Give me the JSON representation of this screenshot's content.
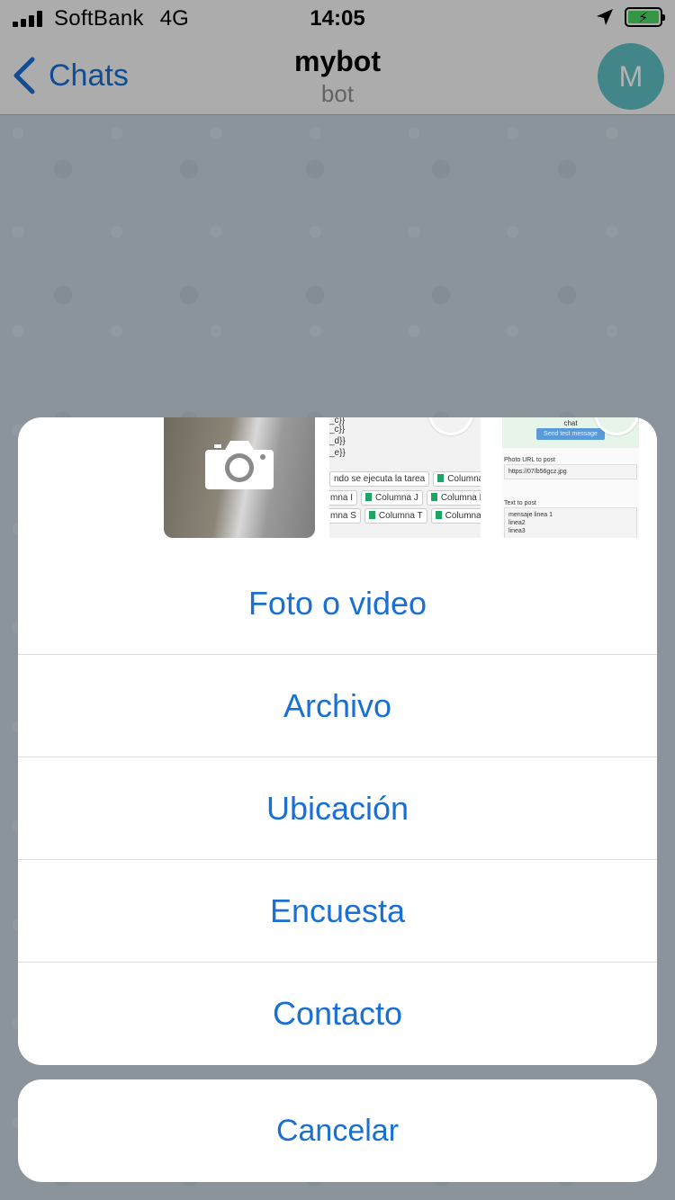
{
  "status": {
    "carrier": "SoftBank",
    "network": "4G",
    "time": "14:05"
  },
  "nav": {
    "back_label": "Chats",
    "title": "mybot",
    "subtitle": "bot",
    "avatar_letter": "M"
  },
  "thumbnails": {
    "sheet_rows": [
      "_c}}",
      "_c}}",
      "_d}}",
      "_e}}"
    ],
    "sheet_chip_first": "ndo se ejecuta la tarea",
    "sheet_chips_row1": [
      "Columna A"
    ],
    "sheet_chips_row2": [
      "mna I",
      "Columna J",
      "Columna K"
    ],
    "sheet_chips_row3": [
      "mna S",
      "Columna T",
      "Columna U"
    ],
    "form_chat": "chat",
    "form_send": "Send test message",
    "form_photo_label": "Photo URL to post",
    "form_photo_value": "https://07/b56gcz.jpg",
    "form_text_label": "Text to post",
    "form_text_lines": [
      "mensaje linea 1",
      "linea2",
      "linea3"
    ]
  },
  "sheet": {
    "options": [
      "Foto o video",
      "Archivo",
      "Ubicación",
      "Encuesta",
      "Contacto"
    ],
    "cancel": "Cancelar"
  },
  "colors": {
    "accent": "#1a6fd3",
    "avatar": "#5fc1c4",
    "battery": "#4cd964"
  }
}
